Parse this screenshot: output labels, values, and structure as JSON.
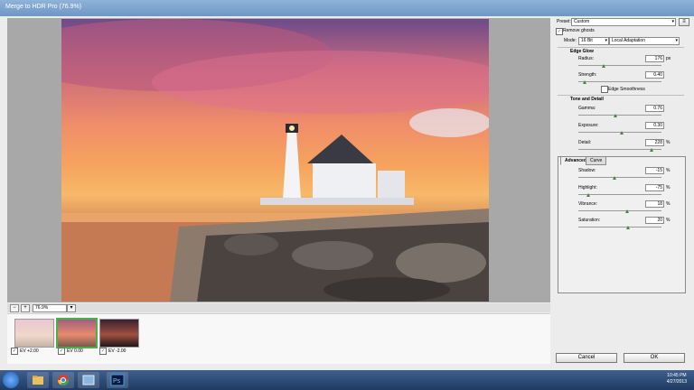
{
  "window": {
    "title": "Merge to HDR Pro (76.9%)"
  },
  "zoom": {
    "value": "76.9%"
  },
  "filmstrip": [
    {
      "label": "EV +2.00",
      "checked": true,
      "selected": false
    },
    {
      "label": "EV 0.00",
      "checked": true,
      "selected": true
    },
    {
      "label": "EV -2.00",
      "checked": true,
      "selected": false
    }
  ],
  "panel": {
    "preset_label": "Preset:",
    "preset_value": "Custom",
    "remove_ghosts": "Remove ghosts",
    "mode_label": "Mode:",
    "mode_bit": "16 Bit",
    "mode_method": "Local Adaptation",
    "edge_glow": "Edge Glow",
    "radius_label": "Radius:",
    "radius_value": "176",
    "radius_unit": "px",
    "radius_level": 0.3,
    "strength_label": "Strength:",
    "strength_value": "0.40",
    "strength_level": 0.08,
    "edge_smoothness": "Edge Smoothness",
    "tone_detail": "Tone and Detail",
    "gamma_label": "Gamma:",
    "gamma_value": "0.76",
    "gamma_level": 0.45,
    "exposure_label": "Exposure:",
    "exposure_value": "0.30",
    "exposure_level": 0.52,
    "detail_label": "Detail:",
    "detail_value": "228",
    "detail_unit": "%",
    "detail_level": 0.88,
    "tab_advanced": "Advanced",
    "tab_curve": "Curve",
    "shadow_label": "Shadow:",
    "shadow_value": "-15",
    "shadow_unit": "%",
    "shadow_level": 0.43,
    "highlight_label": "Highlight:",
    "highlight_value": "-75",
    "highlight_unit": "%",
    "highlight_level": 0.12,
    "vibrance_label": "Vibrance:",
    "vibrance_value": "18",
    "vibrance_unit": "%",
    "vibrance_level": 0.59,
    "saturation_label": "Saturation:",
    "saturation_value": "20",
    "saturation_unit": "%",
    "saturation_level": 0.6,
    "cancel": "Cancel",
    "ok": "OK"
  },
  "taskbar": {
    "time": "10:45 PM",
    "date": "4/27/2013"
  }
}
